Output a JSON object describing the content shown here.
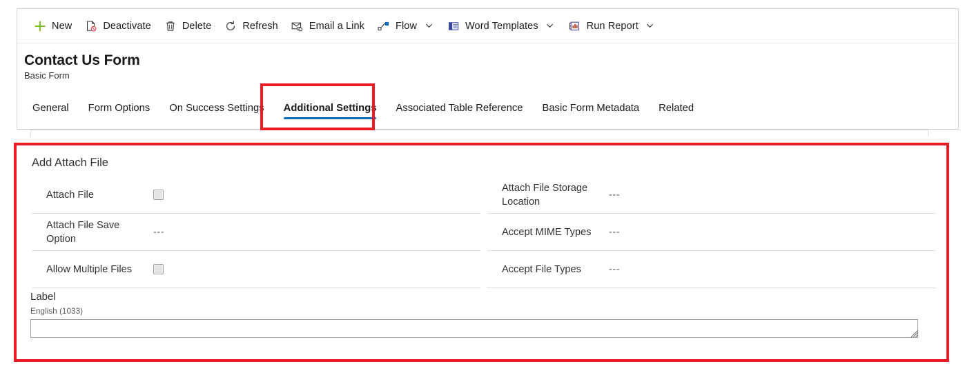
{
  "colors": {
    "accent": "#0f6cbd",
    "annotation": "#ed1c24",
    "text": "#323130",
    "text_strong": "#1b1a19",
    "muted": "#605e5c",
    "divider": "#e1dfdd"
  },
  "commandbar": {
    "items": [
      {
        "label": "New",
        "icon": "plus-icon",
        "caret": false
      },
      {
        "label": "Deactivate",
        "icon": "deactivate-icon",
        "caret": false
      },
      {
        "label": "Delete",
        "icon": "trash-icon",
        "caret": false
      },
      {
        "label": "Refresh",
        "icon": "refresh-icon",
        "caret": false
      },
      {
        "label": "Email a Link",
        "icon": "email-link-icon",
        "caret": false
      },
      {
        "label": "Flow",
        "icon": "flow-icon",
        "caret": true
      },
      {
        "label": "Word Templates",
        "icon": "word-template-icon",
        "caret": true
      },
      {
        "label": "Run Report",
        "icon": "run-report-icon",
        "caret": true
      }
    ]
  },
  "record": {
    "title": "Contact Us Form",
    "subtitle": "Basic Form"
  },
  "tabs": {
    "items": [
      {
        "label": "General",
        "selected": false
      },
      {
        "label": "Form Options",
        "selected": false
      },
      {
        "label": "On Success Settings",
        "selected": false
      },
      {
        "label": "Additional Settings",
        "selected": true
      },
      {
        "label": "Associated Table Reference",
        "selected": false
      },
      {
        "label": "Basic Form Metadata",
        "selected": false
      },
      {
        "label": "Related",
        "selected": false
      }
    ],
    "selected": "Additional Settings"
  },
  "section": {
    "title": "Add Attach File",
    "left_fields": [
      {
        "label": "Attach File",
        "type": "checkbox",
        "value": "",
        "checked": false
      },
      {
        "label": "Attach File Save Option",
        "type": "text",
        "value": "---"
      },
      {
        "label": "Allow Multiple Files",
        "type": "checkbox",
        "value": "",
        "checked": false
      }
    ],
    "right_fields": [
      {
        "label": "Attach File Storage Location",
        "type": "text",
        "value": "---"
      },
      {
        "label": "Accept MIME Types",
        "type": "text",
        "value": "---"
      },
      {
        "label": "Accept File Types",
        "type": "text",
        "value": "---"
      }
    ],
    "label_field": {
      "title": "Label",
      "language": "English (1033)",
      "value": "",
      "placeholder": ""
    }
  },
  "annotations": [
    {
      "name": "tab-highlight",
      "target": "Additional Settings"
    },
    {
      "name": "section-highlight",
      "target": "Add Attach File"
    }
  ]
}
